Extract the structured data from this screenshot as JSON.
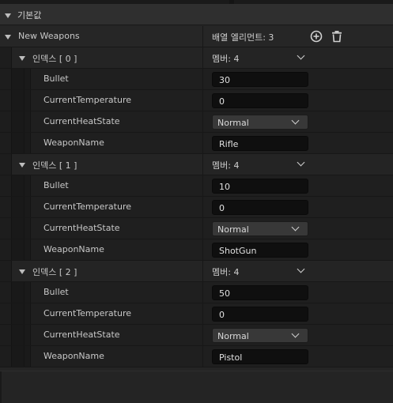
{
  "section": {
    "title": "기본값"
  },
  "array": {
    "name": "New Weapons",
    "summary": "배열 엘리먼트: 3",
    "add_icon": "plus-circle-icon",
    "delete_icon": "trash-icon"
  },
  "elements": [
    {
      "label": "인덱스 [ 0 ]",
      "members": "멤버: 4",
      "props": [
        {
          "name": "Bullet",
          "kind": "input",
          "value": "30"
        },
        {
          "name": "CurrentTemperature",
          "kind": "input",
          "value": "0"
        },
        {
          "name": "CurrentHeatState",
          "kind": "combo",
          "value": "Normal"
        },
        {
          "name": "WeaponName",
          "kind": "text",
          "value": "Rifle"
        }
      ]
    },
    {
      "label": "인덱스 [ 1 ]",
      "members": "멤버: 4",
      "props": [
        {
          "name": "Bullet",
          "kind": "input",
          "value": "10"
        },
        {
          "name": "CurrentTemperature",
          "kind": "input",
          "value": "0"
        },
        {
          "name": "CurrentHeatState",
          "kind": "combo",
          "value": "Normal"
        },
        {
          "name": "WeaponName",
          "kind": "text",
          "value": "ShotGun"
        }
      ]
    },
    {
      "label": "인덱스 [ 2 ]",
      "members": "멤버: 4",
      "props": [
        {
          "name": "Bullet",
          "kind": "input",
          "value": "50"
        },
        {
          "name": "CurrentTemperature",
          "kind": "input",
          "value": "0"
        },
        {
          "name": "CurrentHeatState",
          "kind": "combo",
          "value": "Normal"
        },
        {
          "name": "WeaponName",
          "kind": "text",
          "value": "Pistol"
        }
      ]
    }
  ]
}
